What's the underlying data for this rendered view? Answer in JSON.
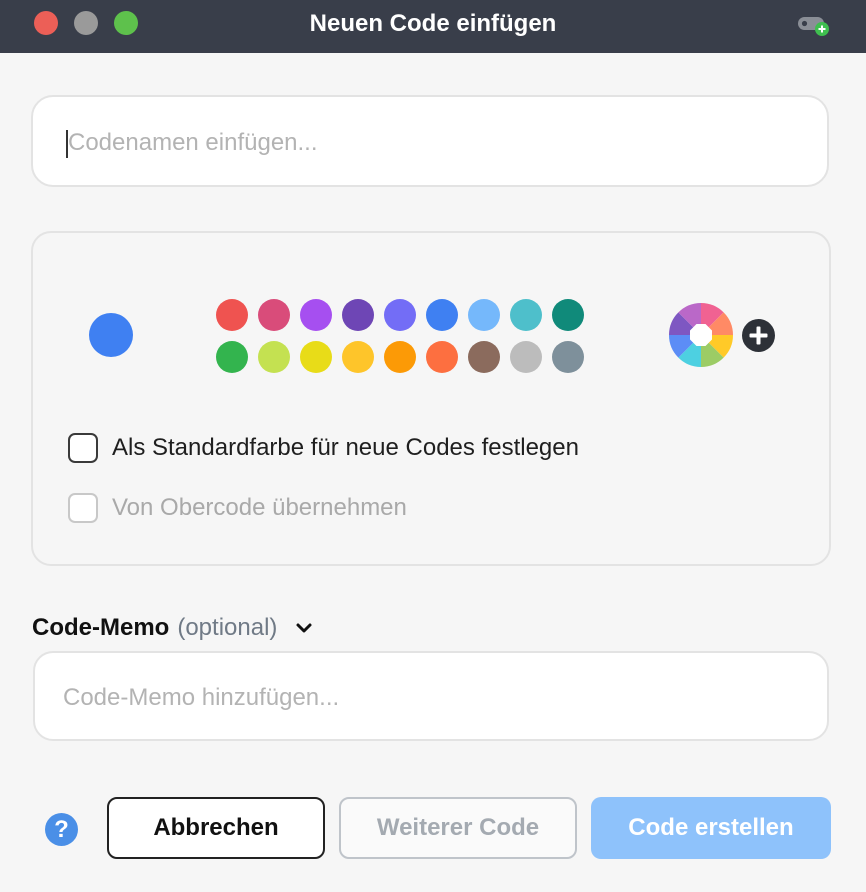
{
  "window": {
    "title": "Neuen Code einfügen",
    "controls": [
      "close",
      "minimize",
      "maximize"
    ],
    "corner_icon": "tag-add-icon"
  },
  "code_name": {
    "value": "",
    "placeholder": "Codenamen einfügen..."
  },
  "color_picker": {
    "selected_color": "#3f80f2",
    "swatches_row1": [
      "#ef5350",
      "#d94c7a",
      "#a64ff0",
      "#6e46b5",
      "#736df6",
      "#3f80f2",
      "#75b8fb",
      "#4ebfcb",
      "#108a7a"
    ],
    "swatches_row2": [
      "#33b44e",
      "#c4e151",
      "#e8dc18",
      "#fec52a",
      "#fc9a06",
      "#fd6f40",
      "#8b6b5d",
      "#bcbcbc",
      "#7e909b"
    ],
    "custom_color_icon": "color-wheel-icon",
    "add_icon": "plus-circle-icon"
  },
  "options": {
    "default_color_label": "Als Standardfarbe für neue Codes festlegen",
    "default_color_checked": false,
    "inherit_label": "Von Obercode übernehmen",
    "inherit_checked": false,
    "inherit_disabled": true
  },
  "memo": {
    "title": "Code-Memo",
    "optional": "(optional)",
    "placeholder": "Code-Memo hinzufügen..."
  },
  "footer": {
    "help_label": "?",
    "cancel_label": "Abbrechen",
    "next_label": "Weiterer Code",
    "create_label": "Code erstellen"
  },
  "colors": {
    "accent": "#4a8fe7",
    "primary_disabled": "#8ec2fb",
    "titlebar": "#393e4a"
  }
}
